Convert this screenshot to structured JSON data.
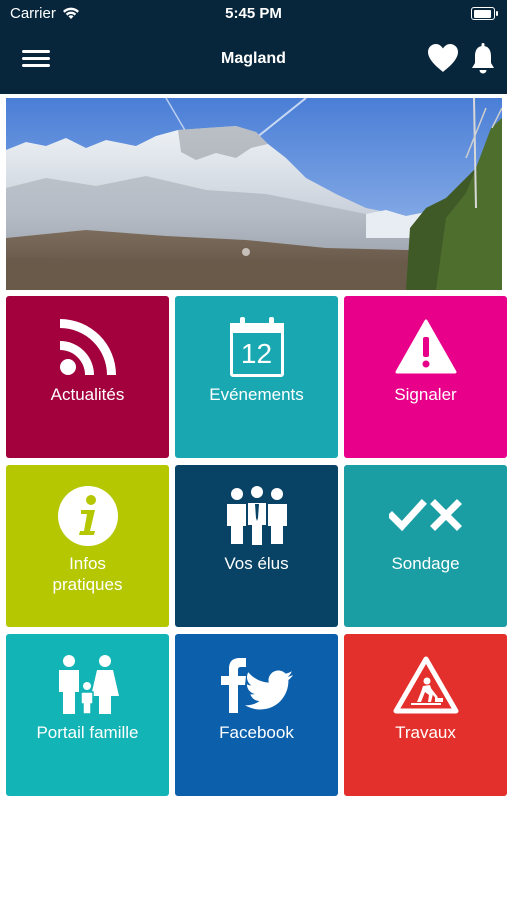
{
  "status_bar": {
    "carrier": "Carrier",
    "time": "5:45 PM"
  },
  "header": {
    "title": "Magland"
  },
  "colors": {
    "header_bg": "#08263b",
    "actualites": "#a3003e",
    "evenements": "#19a8b2",
    "signaler": "#e8008a",
    "infos": "#b4c700",
    "elus": "#084264",
    "sondage": "#1a9ea3",
    "portail": "#12b4b5",
    "facebook": "#0c5fab",
    "travaux": "#e4302c"
  },
  "tiles": [
    {
      "label": "Actualités",
      "icon": "rss-icon"
    },
    {
      "label": "Evénements",
      "icon": "calendar-icon",
      "calendar_day": "12"
    },
    {
      "label": "Signaler",
      "icon": "warning-icon"
    },
    {
      "label_line1": "Infos",
      "label_line2": "pratiques",
      "icon": "info-icon"
    },
    {
      "label": "Vos élus",
      "icon": "people-icon"
    },
    {
      "label": "Sondage",
      "icon": "check-cross-icon"
    },
    {
      "label": "Portail famille",
      "icon": "family-icon"
    },
    {
      "label": "Facebook",
      "icon": "facebook-twitter-icon"
    },
    {
      "label": "Travaux",
      "icon": "roadwork-icon"
    }
  ]
}
